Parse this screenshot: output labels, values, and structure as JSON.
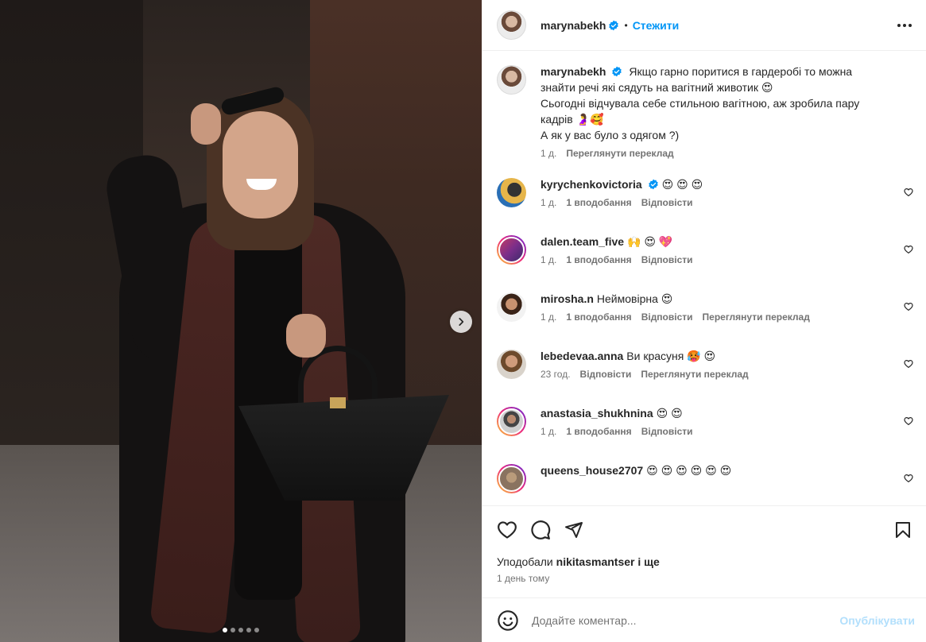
{
  "post": {
    "author": {
      "username": "marynabekh",
      "verified": true,
      "follow_label": "Стежити",
      "separator": "•"
    },
    "media": {
      "slide_count": 5,
      "active_slide": 1,
      "next_icon": "chevron-right-icon"
    },
    "caption": {
      "username": "marynabekh",
      "verified": true,
      "lines": [
        "Якщо гарно поритися в гардеробі то можна знайти речі які сядуть на вагітний животик 😍",
        "Сьогодні відчувала себе стильною вагітною, аж зробила пару кадрів 🤰🥰",
        "А як у вас було з одягом ?)"
      ],
      "time": "1 д.",
      "translate": "Переглянути переклад"
    },
    "comments": [
      {
        "username": "kyrychenkovictoria",
        "verified": true,
        "text": "😍 😍 😍",
        "time": "1 д.",
        "likes": "1 вподобання",
        "reply": "Відповісти",
        "translate": ""
      },
      {
        "username": "dalen.team_five",
        "verified": false,
        "text": "🙌 😍 💖",
        "time": "1 д.",
        "likes": "1 вподобання",
        "reply": "Відповісти",
        "translate": ""
      },
      {
        "username": "mirosha.n",
        "verified": false,
        "text": "Неймовірна 😍",
        "time": "1 д.",
        "likes": "1 вподобання",
        "reply": "Відповісти",
        "translate": "Переглянути переклад"
      },
      {
        "username": "lebedevaa.anna",
        "verified": false,
        "text": "Ви красуня 🥵 😍",
        "time": "23 год.",
        "likes": "",
        "reply": "Відповісти",
        "translate": "Переглянути переклад"
      },
      {
        "username": "anastasia_shukhnina",
        "verified": false,
        "text": "😍 😍",
        "time": "1 д.",
        "likes": "1 вподобання",
        "reply": "Відповісти",
        "translate": ""
      },
      {
        "username": "queens_house2707",
        "verified": false,
        "text": "😍 😍 😍 😍 😍 😍",
        "time": "",
        "likes": "",
        "reply": "",
        "translate": ""
      }
    ],
    "likes": {
      "prefix": "Уподобали",
      "user": "nikitasmantser",
      "suffix": "і ще"
    },
    "posted_time": "1 день тому",
    "add_comment": {
      "placeholder": "Додайте коментар...",
      "post_label": "Опублікувати"
    },
    "colors": {
      "link": "#0095f6",
      "post_disabled": "#b2dffc",
      "secondary_text": "#737373",
      "verified": "#0095f6"
    }
  }
}
